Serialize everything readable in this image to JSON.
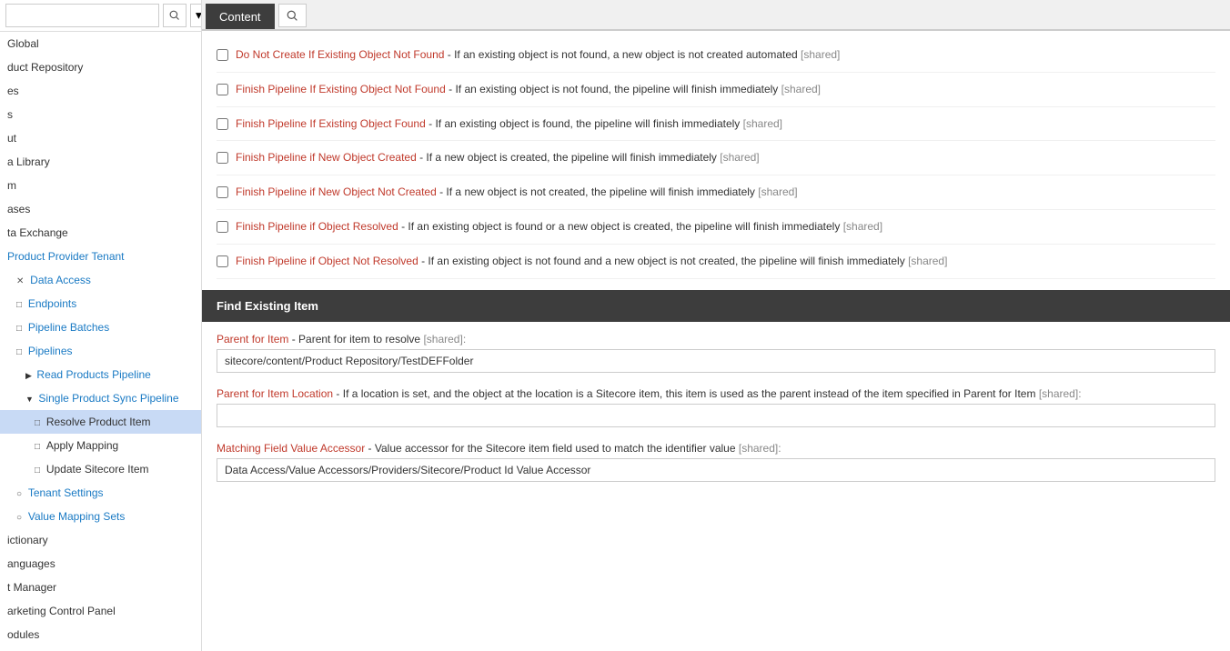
{
  "sidebar": {
    "search_placeholder": "",
    "items": [
      {
        "id": "global",
        "label": "Global",
        "level": 0,
        "indent": 8,
        "icon": "",
        "expandable": false
      },
      {
        "id": "product-repository",
        "label": "duct Repository",
        "level": 0,
        "indent": 8,
        "icon": "",
        "expandable": false
      },
      {
        "id": "es",
        "label": "es",
        "level": 0,
        "indent": 8,
        "icon": "",
        "expandable": false
      },
      {
        "id": "s",
        "label": "s",
        "level": 0,
        "indent": 8,
        "icon": "",
        "expandable": false
      },
      {
        "id": "ut",
        "label": "ut",
        "level": 0,
        "indent": 8,
        "icon": "",
        "expandable": false
      },
      {
        "id": "a-library",
        "label": "a Library",
        "level": 0,
        "indent": 8,
        "icon": "",
        "expandable": false
      },
      {
        "id": "m",
        "label": "m",
        "level": 0,
        "indent": 8,
        "icon": "",
        "expandable": false
      },
      {
        "id": "ases",
        "label": "ases",
        "level": 0,
        "indent": 8,
        "icon": "",
        "expandable": false
      },
      {
        "id": "ta-exchange",
        "label": "ta Exchange",
        "level": 0,
        "indent": 8,
        "icon": "",
        "expandable": false
      },
      {
        "id": "product-provider-tenant",
        "label": "Product Provider Tenant",
        "level": 0,
        "indent": 8,
        "icon": "",
        "expandable": false
      },
      {
        "id": "data-access",
        "label": "Data Access",
        "level": 1,
        "indent": 18,
        "icon": "✕",
        "expandable": false
      },
      {
        "id": "endpoints",
        "label": "Endpoints",
        "level": 1,
        "indent": 18,
        "icon": "□",
        "expandable": false
      },
      {
        "id": "pipeline-batches",
        "label": "Pipeline Batches",
        "level": 1,
        "indent": 18,
        "icon": "□",
        "expandable": false
      },
      {
        "id": "pipelines",
        "label": "Pipelines",
        "level": 1,
        "indent": 18,
        "icon": "□",
        "expandable": false
      },
      {
        "id": "read-products-pipeline",
        "label": "Read Products Pipeline",
        "level": 2,
        "indent": 28,
        "icon": "▶",
        "expandable": true
      },
      {
        "id": "single-product-sync",
        "label": "Single Product Sync Pipeline",
        "level": 2,
        "indent": 28,
        "icon": "▼",
        "expandable": true,
        "expanded": true
      },
      {
        "id": "resolve-product-item",
        "label": "Resolve Product Item",
        "level": 3,
        "indent": 38,
        "icon": "□",
        "expandable": false,
        "active": true
      },
      {
        "id": "apply-mapping",
        "label": "Apply Mapping",
        "level": 3,
        "indent": 38,
        "icon": "□",
        "expandable": false
      },
      {
        "id": "update-sitecore-item",
        "label": "Update Sitecore Item",
        "level": 3,
        "indent": 38,
        "icon": "□",
        "expandable": false
      },
      {
        "id": "tenant-settings",
        "label": "Tenant Settings",
        "level": 1,
        "indent": 18,
        "icon": "○",
        "expandable": false
      },
      {
        "id": "value-mapping-sets",
        "label": "Value Mapping Sets",
        "level": 1,
        "indent": 18,
        "icon": "○",
        "expandable": false
      },
      {
        "id": "ictionary",
        "label": "ictionary",
        "level": 0,
        "indent": 8,
        "icon": "",
        "expandable": false
      },
      {
        "id": "anguages",
        "label": "anguages",
        "level": 0,
        "indent": 8,
        "icon": "",
        "expandable": false
      },
      {
        "id": "t-manager",
        "label": "t Manager",
        "level": 0,
        "indent": 8,
        "icon": "",
        "expandable": false
      },
      {
        "id": "arketing-control-panel",
        "label": "arketing Control Panel",
        "level": 0,
        "indent": 8,
        "icon": "",
        "expandable": false
      },
      {
        "id": "odules",
        "label": "odules",
        "level": 0,
        "indent": 8,
        "icon": "",
        "expandable": false
      }
    ]
  },
  "tabs": [
    {
      "id": "content",
      "label": "Content",
      "active": true
    },
    {
      "id": "search",
      "label": "",
      "icon": "search"
    }
  ],
  "checkboxes": [
    {
      "id": "cb1",
      "title": "Do Not Create If Existing Object Not Found",
      "desc": " - If an existing object is not found, a new object is not created automated",
      "shared": "[shared]",
      "checked": false
    },
    {
      "id": "cb2",
      "title": "Finish Pipeline If Existing Object Not Found",
      "desc": " - If an existing object is not found, the pipeline will finish immediately",
      "shared": "[shared]",
      "checked": false
    },
    {
      "id": "cb3",
      "title": "Finish Pipeline If Existing Object Found",
      "desc": " - If an existing object is found, the pipeline will finish immediately",
      "shared": "[shared]",
      "checked": false
    },
    {
      "id": "cb4",
      "title": "Finish Pipeline if New Object Created",
      "desc": " - If a new object is created, the pipeline will finish immediately",
      "shared": "[shared]",
      "checked": false
    },
    {
      "id": "cb5",
      "title": "Finish Pipeline if New Object Not Created",
      "desc": " - If a new object is not created, the pipeline will finish immediately",
      "shared": "[shared]",
      "checked": false
    },
    {
      "id": "cb6",
      "title": "Finish Pipeline if Object Resolved",
      "desc": " - If an existing object is found or a new object is created, the pipeline will finish immediately",
      "shared": "[shared]",
      "checked": false
    },
    {
      "id": "cb7",
      "title": "Finish Pipeline if Object Not Resolved",
      "desc": " - If an existing object is not found and a new object is not created, the pipeline will finish immediately",
      "shared": "[shared]",
      "checked": false
    }
  ],
  "section_header": "Find Existing Item",
  "form_fields": [
    {
      "id": "parent-for-item",
      "label_title": "Parent for Item",
      "label_desc": " - Parent for item to resolve",
      "label_shared": "[shared]:",
      "value": "sitecore/content/Product Repository/TestDEFFolder"
    },
    {
      "id": "parent-for-item-location",
      "label_title": "Parent for Item Location",
      "label_desc": " - If a location is set, and the object at the location is a Sitecore item, this item is used as the parent instead of the item specified in Parent for Item",
      "label_shared": "[shared]:",
      "value": ""
    },
    {
      "id": "matching-field-value-accessor",
      "label_title": "Matching Field Value Accessor",
      "label_desc": " - Value accessor for the Sitecore item field used to match the identifier value",
      "label_shared": "[shared]:",
      "value": "Data Access/Value Accessors/Providers/Sitecore/Product Id Value Accessor"
    }
  ]
}
